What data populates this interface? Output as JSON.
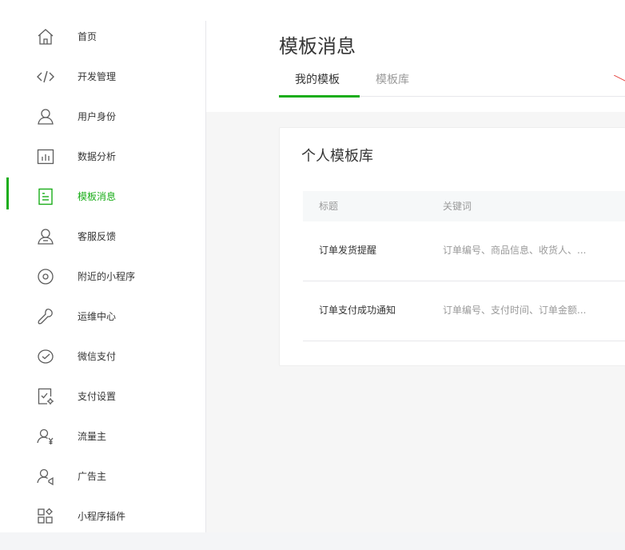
{
  "sidebar": {
    "items": [
      {
        "label": "首页",
        "icon": "home-icon"
      },
      {
        "label": "开发管理",
        "icon": "code-icon"
      },
      {
        "label": "用户身份",
        "icon": "user-icon"
      },
      {
        "label": "数据分析",
        "icon": "chart-icon"
      },
      {
        "label": "模板消息",
        "icon": "template-message-icon",
        "active": true
      },
      {
        "label": "客服反馈",
        "icon": "customer-service-icon"
      },
      {
        "label": "附近的小程序",
        "icon": "location-icon"
      },
      {
        "label": "运维中心",
        "icon": "wrench-icon"
      },
      {
        "label": "微信支付",
        "icon": "wechat-pay-icon"
      },
      {
        "label": "支付设置",
        "icon": "payment-settings-icon"
      },
      {
        "label": "流量主",
        "icon": "traffic-owner-icon"
      },
      {
        "label": "广告主",
        "icon": "advertiser-icon"
      },
      {
        "label": "小程序插件",
        "icon": "plugins-icon"
      }
    ],
    "accent_color": "#1aad19"
  },
  "main": {
    "title": "模板消息",
    "tabs": [
      {
        "label": "我的模板",
        "active": true
      },
      {
        "label": "模板库",
        "active": false
      }
    ],
    "card": {
      "title": "个人模板库",
      "columns": [
        "标题",
        "关键词"
      ],
      "rows": [
        {
          "title": "订单发货提醒",
          "keywords": "订单编号、商品信息、收货人、..."
        },
        {
          "title": "订单支付成功通知",
          "keywords": "订单编号、支付时间、订单金额..."
        }
      ]
    }
  }
}
